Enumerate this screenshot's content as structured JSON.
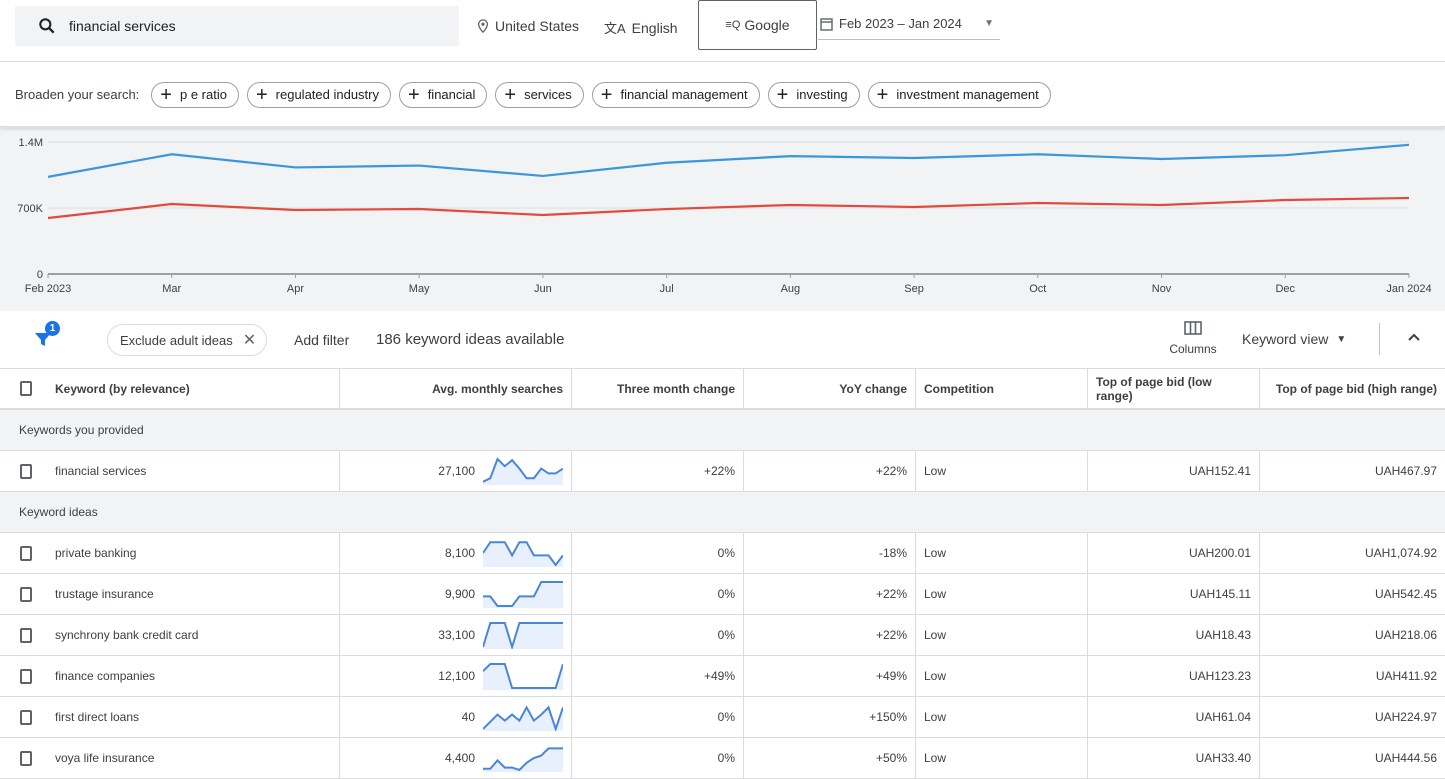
{
  "search": {
    "query": "financial services",
    "location": "United States",
    "language": "English",
    "network": "Google",
    "date_range": "Feb 2023 – Jan 2024"
  },
  "broaden": {
    "label": "Broaden your search:",
    "chips": [
      "p e ratio",
      "regulated industry",
      "financial",
      "services",
      "financial management",
      "investing",
      "investment management"
    ]
  },
  "chart_data": {
    "type": "line",
    "x": [
      "Feb 2023",
      "Mar",
      "Apr",
      "May",
      "Jun",
      "Jul",
      "Aug",
      "Sep",
      "Oct",
      "Nov",
      "Dec",
      "Jan 2024"
    ],
    "yticks": [
      "0",
      "700K",
      "1.4M"
    ],
    "ylim": [
      0,
      1400000
    ],
    "grid": true,
    "series": [
      {
        "color": "#3b96db",
        "values": [
          1030000,
          1270000,
          1130000,
          1150000,
          1040000,
          1180000,
          1250000,
          1230000,
          1270000,
          1220000,
          1260000,
          1370000
        ]
      },
      {
        "color": "#e04a3f",
        "values": [
          594000,
          742000,
          679000,
          689000,
          626000,
          689000,
          732000,
          711000,
          753000,
          732000,
          785000,
          806000
        ]
      }
    ]
  },
  "filters": {
    "badge": "1",
    "chip": "Exclude adult ideas",
    "add": "Add filter",
    "count": "186 keyword ideas available",
    "columns": "Columns",
    "view": "Keyword view"
  },
  "table": {
    "headers": [
      "Keyword (by relevance)",
      "Avg. monthly searches",
      "Three month change",
      "YoY change",
      "Competition",
      "Top of page bid (low range)",
      "Top of page bid (high range)"
    ],
    "group1": "Keywords you provided",
    "group2": "Keyword ideas",
    "provided": [
      {
        "keyword": "financial services",
        "searches": "27,100",
        "three": "+22%",
        "yoy": "+22%",
        "comp": "Low",
        "low": "UAH152.41",
        "high": "UAH467.97",
        "trend": [
          0.05,
          0.2,
          1,
          0.7,
          0.95,
          0.6,
          0.2,
          0.2,
          0.6,
          0.4,
          0.4,
          0.6
        ]
      }
    ],
    "ideas": [
      {
        "keyword": "private banking",
        "searches": "8,100",
        "three": "0%",
        "yoy": "-18%",
        "comp": "Low",
        "low": "UAH200.01",
        "high": "UAH1,074.92",
        "trend": [
          0.5,
          0.95,
          0.95,
          0.95,
          0.4,
          0.95,
          0.95,
          0.4,
          0.4,
          0.4,
          0,
          0.4
        ]
      },
      {
        "keyword": "trustage insurance",
        "searches": "9,900",
        "three": "0%",
        "yoy": "+22%",
        "comp": "Low",
        "low": "UAH145.11",
        "high": "UAH542.45",
        "trend": [
          0.4,
          0.4,
          0,
          0,
          0,
          0.4,
          0.4,
          0.4,
          1,
          1,
          1,
          1
        ]
      },
      {
        "keyword": "synchrony bank credit card",
        "searches": "33,100",
        "three": "0%",
        "yoy": "+22%",
        "comp": "Low",
        "low": "UAH18.43",
        "high": "UAH218.06",
        "trend": [
          0,
          1,
          1,
          1,
          0,
          1,
          1,
          1,
          1,
          1,
          1,
          1
        ]
      },
      {
        "keyword": "finance companies",
        "searches": "12,100",
        "three": "+49%",
        "yoy": "+49%",
        "comp": "Low",
        "low": "UAH123.23",
        "high": "UAH411.92",
        "trend": [
          0.7,
          1,
          1,
          1,
          0,
          0,
          0,
          0,
          0,
          0,
          0,
          1
        ]
      },
      {
        "keyword": "first direct loans",
        "searches": "40",
        "three": "0%",
        "yoy": "+150%",
        "comp": "Low",
        "low": "UAH61.04",
        "high": "UAH224.97",
        "trend": [
          0,
          0.3,
          0.6,
          0.35,
          0.6,
          0.35,
          0.9,
          0.35,
          0.6,
          0.9,
          0,
          0.9
        ]
      },
      {
        "keyword": "voya life insurance",
        "searches": "4,400",
        "three": "0%",
        "yoy": "+50%",
        "comp": "Low",
        "low": "UAH33.40",
        "high": "UAH444.56",
        "trend": [
          0.05,
          0.05,
          0.4,
          0.1,
          0.1,
          0,
          0.3,
          0.5,
          0.6,
          0.9,
          0.9,
          0.9
        ]
      }
    ]
  }
}
